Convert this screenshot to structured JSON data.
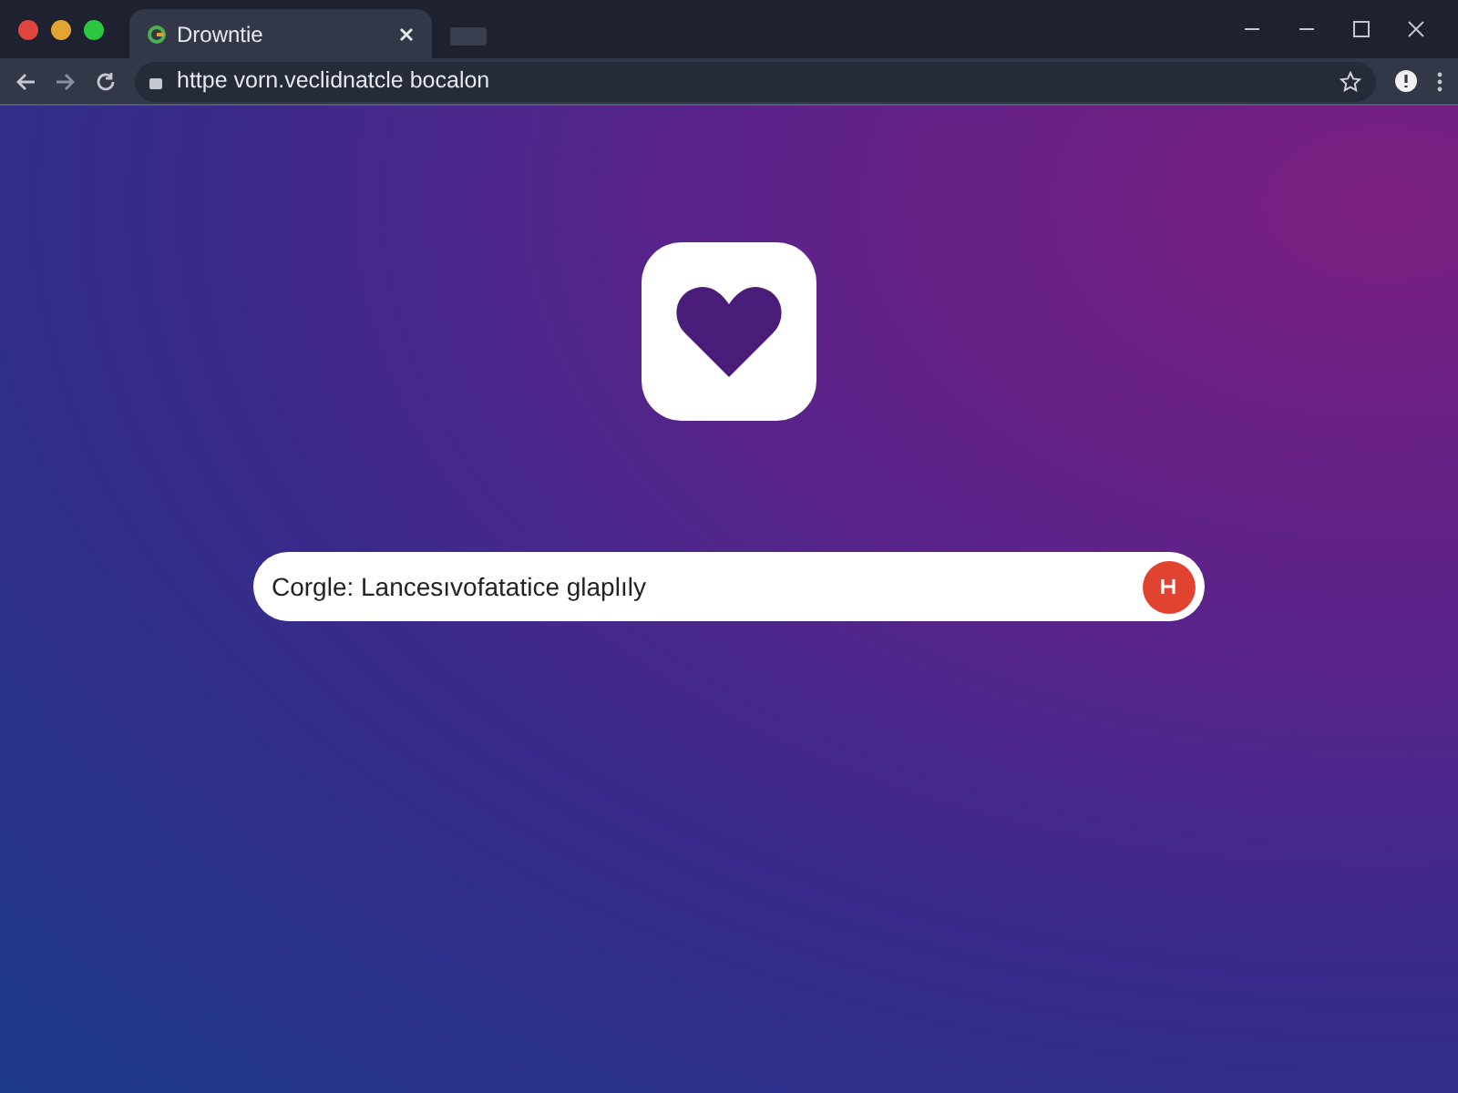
{
  "tabs": [
    {
      "title": "Drowntie",
      "selected": true
    }
  ],
  "address_bar": {
    "value": "httpe vorn.veclidnatcle bocalon"
  },
  "search": {
    "value": "Corgle: Lancesıvofatatice glaplıly"
  }
}
